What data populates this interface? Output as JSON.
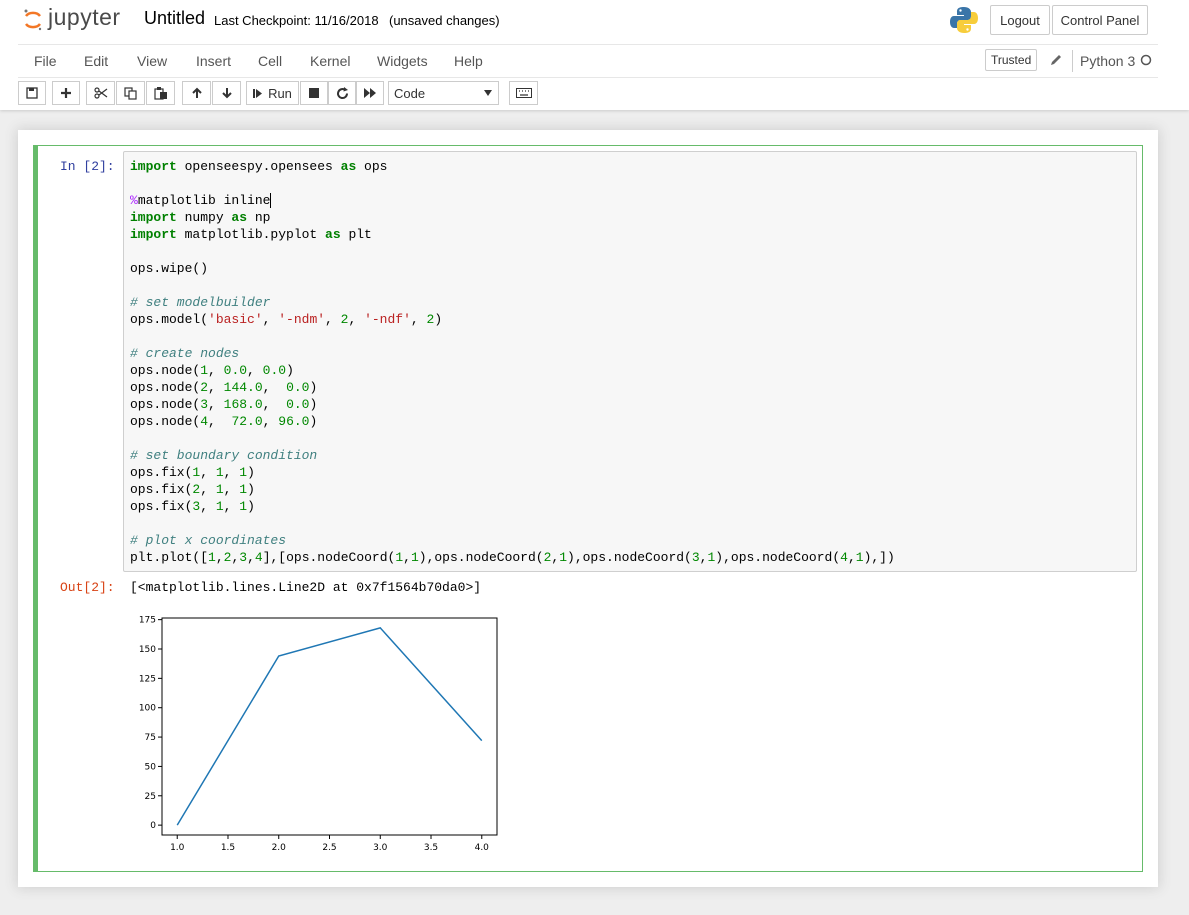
{
  "header": {
    "logo_text": "jupyter",
    "notebook_name": "Untitled",
    "checkpoint": "Last Checkpoint: 11/16/2018",
    "autosave_status": "(unsaved changes)",
    "logout_label": "Logout",
    "control_panel_label": "Control Panel"
  },
  "menubar": {
    "items": [
      "File",
      "Edit",
      "View",
      "Insert",
      "Cell",
      "Kernel",
      "Widgets",
      "Help"
    ],
    "trusted_label": "Trusted",
    "kernel_name": "Python 3"
  },
  "toolbar": {
    "run_label": "Run",
    "cell_type": "Code",
    "icons": [
      "save-icon",
      "plus-icon",
      "cut-icon",
      "copy-icon",
      "paste-icon",
      "arrow-up-icon",
      "arrow-down-icon",
      "step-forward-icon",
      "stop-icon",
      "restart-icon",
      "fast-forward-icon",
      "keyboard-icon"
    ]
  },
  "cell": {
    "in_prompt": "In [2]:",
    "out_prompt": "Out[2]:",
    "output_text": "[<matplotlib.lines.Line2D at 0x7f1564b70da0>]",
    "code_lines": [
      "import openseespy.opensees as ops",
      "",
      "%matplotlib inline",
      "import numpy as np",
      "import matplotlib.pyplot as plt",
      "",
      "ops.wipe()",
      "",
      "# set modelbuilder",
      "ops.model('basic', '-ndm', 2, '-ndf', 2)",
      "",
      "# create nodes",
      "ops.node(1, 0.0, 0.0)",
      "ops.node(2, 144.0,  0.0)",
      "ops.node(3, 168.0,  0.0)",
      "ops.node(4,  72.0, 96.0)",
      "",
      "# set boundary condition",
      "ops.fix(1, 1, 1)",
      "ops.fix(2, 1, 1)",
      "ops.fix(3, 1, 1)",
      "",
      "# plot x coordinates",
      "plt.plot([1,2,3,4],[ops.nodeCoord(1,1),ops.nodeCoord(2,1),ops.nodeCoord(3,1),ops.nodeCoord(4,1),])"
    ]
  },
  "chart_data": {
    "type": "line",
    "x": [
      1,
      2,
      3,
      4
    ],
    "series": [
      {
        "values": [
          0,
          144,
          168,
          72
        ],
        "color": "#1f77b4"
      }
    ],
    "xticks": [
      "1.0",
      "1.5",
      "2.0",
      "2.5",
      "3.0",
      "3.5",
      "4.0"
    ],
    "yticks": [
      "0",
      "25",
      "50",
      "75",
      "100",
      "125",
      "150",
      "175"
    ],
    "xlim": [
      0.85,
      4.15
    ],
    "ylim": [
      -8.4,
      176.4
    ],
    "grid": false
  },
  "colors": {
    "cell_border": "#66bb6a",
    "in_prompt": "#303f9f",
    "out_prompt": "#d84315",
    "logo_orange": "#f37726"
  }
}
